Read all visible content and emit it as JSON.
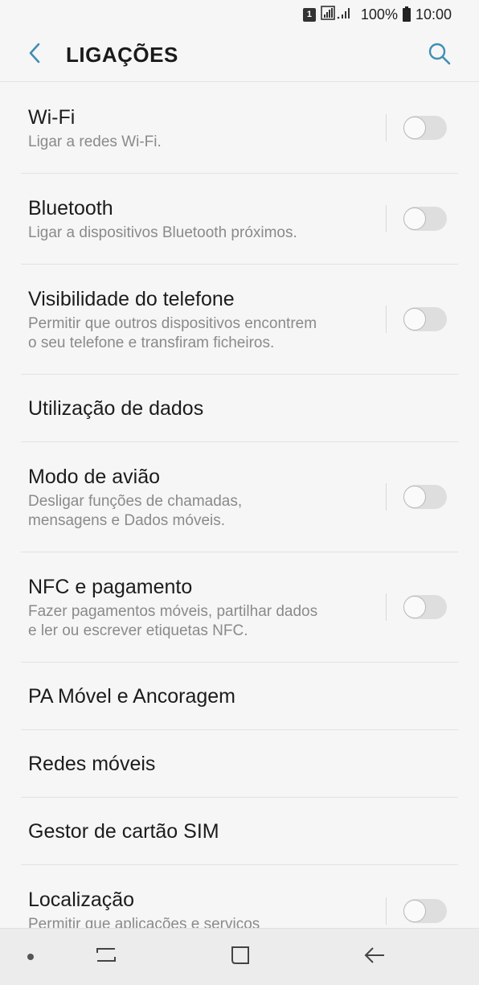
{
  "status_bar": {
    "sim_badge": "1",
    "battery_percent": "100%",
    "time": "10:00"
  },
  "app_bar": {
    "title": "LIGAÇÕES"
  },
  "settings": [
    {
      "title": "Wi-Fi",
      "subtitle": "Ligar a redes Wi-Fi.",
      "has_toggle": true,
      "toggle_on": false
    },
    {
      "title": "Bluetooth",
      "subtitle": "Ligar a dispositivos Bluetooth próximos.",
      "has_toggle": true,
      "toggle_on": false
    },
    {
      "title": "Visibilidade do telefone",
      "subtitle_lines": [
        "Permitir que outros dispositivos encontrem",
        "o seu telefone e transfiram ficheiros."
      ],
      "has_toggle": true,
      "toggle_on": false
    },
    {
      "title": "Utilização de dados"
    },
    {
      "title": "Modo de avião",
      "subtitle_lines": [
        "Desligar funções de chamadas,",
        "mensagens e Dados móveis."
      ],
      "has_toggle": true,
      "toggle_on": false
    },
    {
      "title": "NFC e pagamento",
      "subtitle_lines": [
        "Fazer pagamentos móveis, partilhar dados",
        "e ler ou escrever etiquetas NFC."
      ],
      "has_toggle": true,
      "toggle_on": false
    },
    {
      "title": "PA Móvel e Ancoragem"
    },
    {
      "title": "Redes móveis"
    },
    {
      "title": "Gestor de cartão SIM"
    },
    {
      "title": "Localização",
      "subtitle": "Permitir que aplicações e serviços",
      "has_toggle": true,
      "toggle_on": false
    }
  ],
  "colors": {
    "accent": "#3f8fb3",
    "background": "#f6f6f6",
    "nav_bar": "#ececec"
  },
  "icons": {
    "back": "chevron-left-icon",
    "search": "search-icon",
    "recents": "recents-icon",
    "home": "home-icon",
    "nav_back": "back-arrow-icon"
  }
}
